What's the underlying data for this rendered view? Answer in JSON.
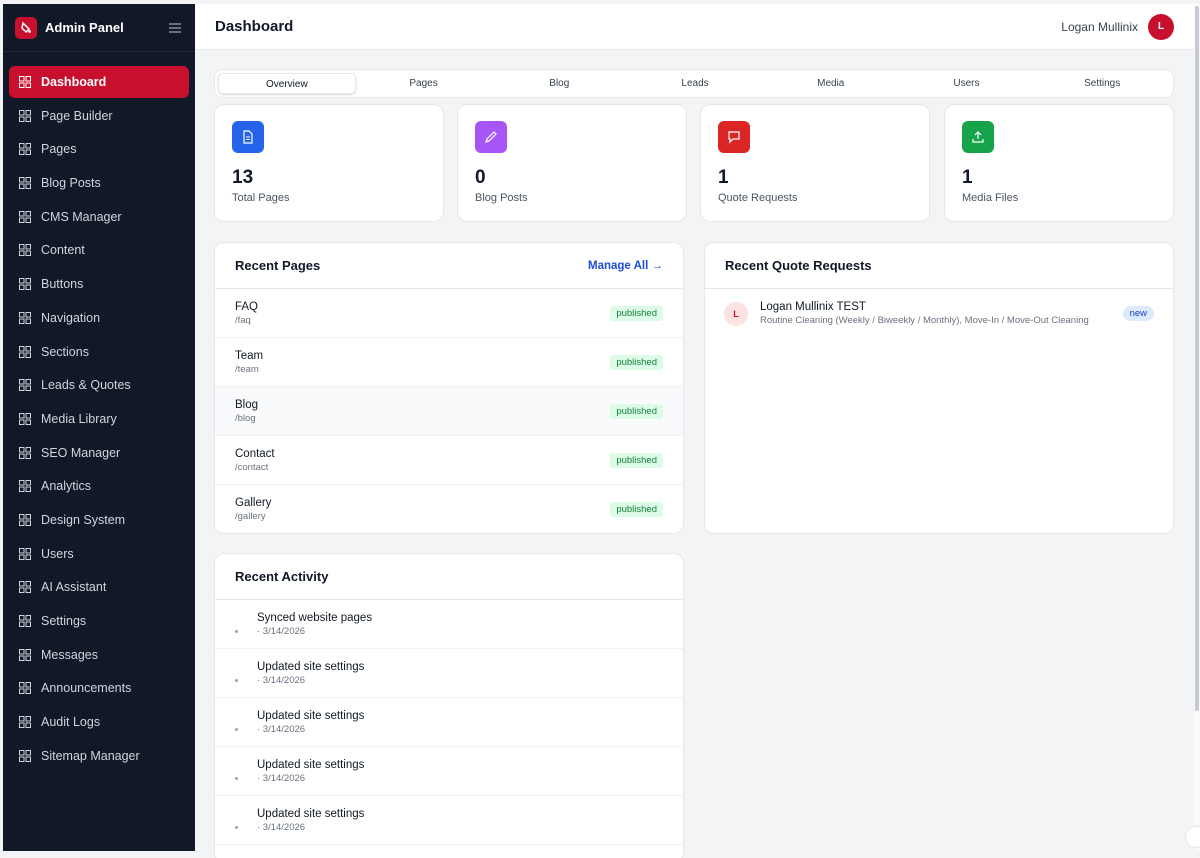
{
  "app": {
    "title": "Admin Panel"
  },
  "header": {
    "title": "Dashboard",
    "user_name": "Logan Mullinix",
    "avatar_initial": "L"
  },
  "sidebar": {
    "items": [
      {
        "label": "Dashboard",
        "active": true
      },
      {
        "label": "Page Builder"
      },
      {
        "label": "Pages"
      },
      {
        "label": "Blog Posts"
      },
      {
        "label": "CMS Manager"
      },
      {
        "label": "Content"
      },
      {
        "label": "Buttons"
      },
      {
        "label": "Navigation"
      },
      {
        "label": "Sections"
      },
      {
        "label": "Leads & Quotes"
      },
      {
        "label": "Media Library"
      },
      {
        "label": "SEO Manager"
      },
      {
        "label": "Analytics"
      },
      {
        "label": "Design System"
      },
      {
        "label": "Users"
      },
      {
        "label": "AI Assistant"
      },
      {
        "label": "Settings"
      },
      {
        "label": "Messages"
      },
      {
        "label": "Announcements"
      },
      {
        "label": "Audit Logs"
      },
      {
        "label": "Sitemap Manager"
      }
    ]
  },
  "tabs": [
    {
      "label": "Overview",
      "active": true
    },
    {
      "label": "Pages"
    },
    {
      "label": "Blog"
    },
    {
      "label": "Leads"
    },
    {
      "label": "Media"
    },
    {
      "label": "Users"
    },
    {
      "label": "Settings"
    }
  ],
  "stats": [
    {
      "value": "13",
      "label": "Total Pages",
      "icon": "document-icon",
      "color": "#2563eb"
    },
    {
      "value": "0",
      "label": "Blog Posts",
      "icon": "pencil-icon",
      "color": "#a855f7"
    },
    {
      "value": "1",
      "label": "Quote Requests",
      "icon": "chat-bubble-icon",
      "color": "#dc2626"
    },
    {
      "value": "1",
      "label": "Media Files",
      "icon": "upload-icon",
      "color": "#16a34a"
    }
  ],
  "recent_pages": {
    "title": "Recent Pages",
    "manage_label": "Manage All →",
    "items": [
      {
        "name": "FAQ",
        "slug": "/faq",
        "status": "published"
      },
      {
        "name": "Team",
        "slug": "/team",
        "status": "published"
      },
      {
        "name": "Blog",
        "slug": "/blog",
        "status": "published"
      },
      {
        "name": "Contact",
        "slug": "/contact",
        "status": "published"
      },
      {
        "name": "Gallery",
        "slug": "/gallery",
        "status": "published"
      }
    ]
  },
  "recent_quotes": {
    "title": "Recent Quote Requests",
    "items": [
      {
        "initial": "L",
        "name": "Logan Mullinix TEST",
        "service": "Routine Cleaning (Weekly / Biweekly / Monthly), Move-In / Move-Out Cleaning",
        "status": "new"
      }
    ]
  },
  "recent_activity": {
    "title": "Recent Activity",
    "items": [
      {
        "text": "Synced website pages",
        "time": "· 3/14/2026"
      },
      {
        "text": "Updated site settings",
        "time": "· 3/14/2026"
      },
      {
        "text": "Updated site settings",
        "time": "· 3/14/2026"
      },
      {
        "text": "Updated site settings",
        "time": "· 3/14/2026"
      },
      {
        "text": "Updated site settings",
        "time": "· 3/14/2026"
      }
    ]
  },
  "colors": {
    "accent": "#c8102e",
    "sidebar_bg": "#111827",
    "published_bg": "#dcfce7",
    "new_badge_bg": "#dbeafe"
  }
}
